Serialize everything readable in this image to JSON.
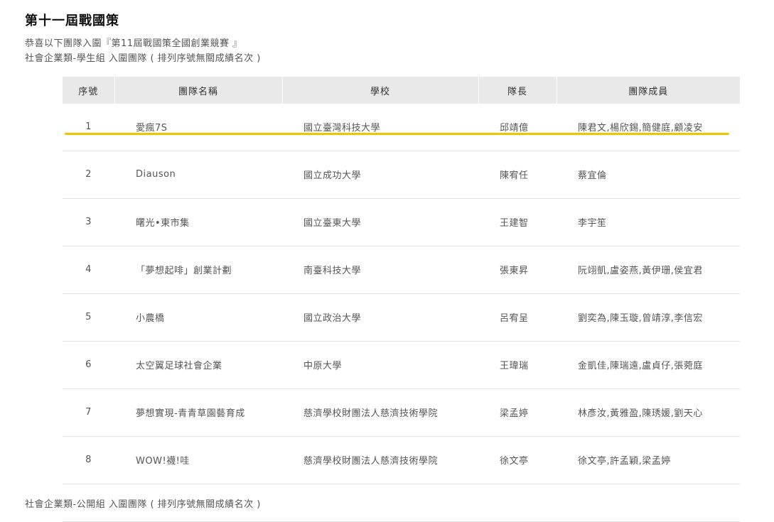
{
  "page": {
    "title": "第十一屆戰國策",
    "intro_line1": "恭喜以下團隊入圍『第11屆戰國策全國創業競賽 』",
    "intro_line2": "社會企業類-學生組 入圍團隊 ( 排列序號無關成績名次 )",
    "footer_line": "社會企業類-公開組 入圍團隊 ( 排列序號無關成績名次 )"
  },
  "table": {
    "headers": [
      "序號",
      "團隊名稱",
      "學校",
      "隊長",
      "團隊成員"
    ],
    "rows": [
      {
        "no": "1",
        "team": "愛瘋7S",
        "school": "國立臺灣科技大學",
        "leader": "邱靖億",
        "members": "陳君文,楊欣錫,簡健庭,顧凌安"
      },
      {
        "no": "2",
        "team": "Diauson",
        "school": "國立成功大學",
        "leader": "陳宥任",
        "members": "蔡宜倫"
      },
      {
        "no": "3",
        "team": "曙光•東市集",
        "school": "國立臺東大學",
        "leader": "王建智",
        "members": "李宇笙"
      },
      {
        "no": "4",
        "team": "「夢想起啡」創業計劃",
        "school": "南臺科技大學",
        "leader": "張東昇",
        "members": "阮翊凱,盧姿燕,黃伊珊,侯宜君"
      },
      {
        "no": "5",
        "team": "小農橋",
        "school": "國立政治大學",
        "leader": "呂宥呈",
        "members": "劉奕為,陳玉璇,曾靖淳,李信宏"
      },
      {
        "no": "6",
        "team": "太空翼足球社會企業",
        "school": "中原大學",
        "leader": "王瑋瑞",
        "members": "金凱佳,陳瑞遠,盧貞仔,張菀庭"
      },
      {
        "no": "7",
        "team": "夢想實現-青青草園藝育成",
        "school": "慈濟學校財團法人慈濟技術學院",
        "leader": "梁孟婷",
        "members": "林彥汝,黃雅盈,陳琇媛,劉天心"
      },
      {
        "no": "8",
        "team": "WOW!襪!哇",
        "school": "慈濟學校財團法人慈濟技術學院",
        "leader": "徐文亭",
        "members": "徐文亭,許孟穎,梁孟婷"
      }
    ]
  },
  "colors": {
    "highlight": "#f2c300",
    "header_bg": "#e9e9e9"
  }
}
